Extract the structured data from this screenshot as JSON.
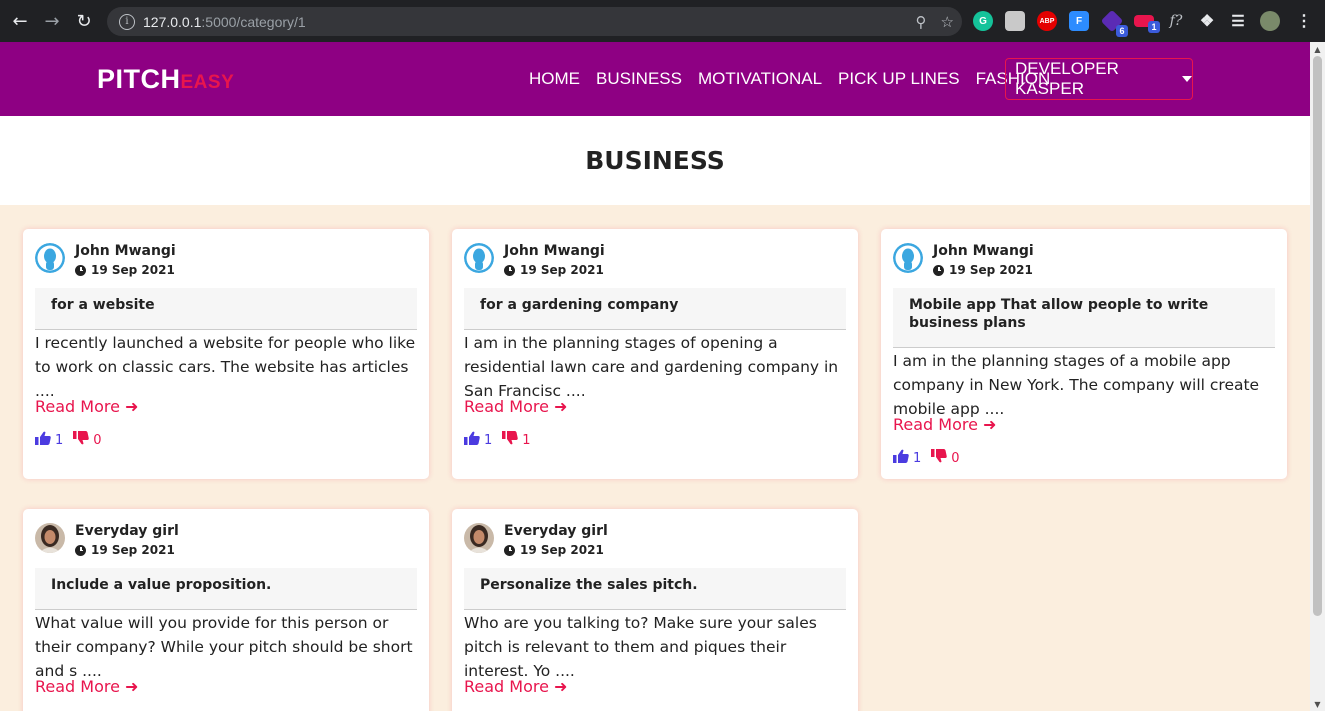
{
  "browser": {
    "url_host": "127.0.0.1",
    "url_path": ":5000/category/1",
    "extensions": [
      {
        "icon": "grammarly-icon",
        "color": "#15c39a",
        "text": "G"
      },
      {
        "icon": "ext-hand-icon",
        "color": "#c9c9c9",
        "text": ""
      },
      {
        "icon": "adblock-icon",
        "color": "#e40000",
        "text": "ABP"
      },
      {
        "icon": "ext-doc-icon",
        "color": "#2d8cff",
        "text": "F"
      },
      {
        "icon": "ext-purple-icon",
        "color": "#5b2bb5",
        "text": "",
        "badge": "6"
      },
      {
        "icon": "ext-toggle-icon",
        "color": "#e8154d",
        "text": "",
        "badge": "1"
      },
      {
        "icon": "formula-icon",
        "color": "",
        "text": "f?"
      }
    ]
  },
  "site": {
    "brand_main": "PITCH",
    "brand_sub": "EASY",
    "nav": [
      "HOME",
      "BUSINESS",
      "MOTIVATIONAL",
      "PICK UP LINES",
      "FASHION"
    ],
    "user_dropdown": "DEVELOPER KASPER",
    "colors": {
      "navbar": "#8e0083",
      "accent": "#e8154d",
      "page_bg": "#fbeede",
      "like": "#4b3be0"
    }
  },
  "category_title": "BUSINESS",
  "read_more_label": "Read More",
  "pitches": [
    {
      "author": "John Mwangi",
      "avatar": "blue-user-avatar",
      "date": "19 Sep 2021",
      "title": "for a website",
      "body": "I recently launched a website for people who like to work on classic cars. The website has articles ....",
      "likes": "1",
      "dislikes": "0"
    },
    {
      "author": "John Mwangi",
      "avatar": "blue-user-avatar",
      "date": "19 Sep 2021",
      "title": "for a gardening company",
      "body": "I am in the planning stages of opening a residential lawn care and gardening company in San Francisc ....",
      "likes": "1",
      "dislikes": "1"
    },
    {
      "author": "John Mwangi",
      "avatar": "blue-user-avatar",
      "date": "19 Sep 2021",
      "title": "Mobile app That allow people to write business plans",
      "body": "I am in the planning stages of a mobile app company in New York. The company will create mobile app ....",
      "likes": "1",
      "dislikes": "0"
    },
    {
      "author": "Everyday girl",
      "avatar": "photo-avatar",
      "date": "19 Sep 2021",
      "title": "Include a value proposition.",
      "body": "What value will you provide for this person or their company? While your pitch should be short and s ....",
      "likes": "",
      "dislikes": ""
    },
    {
      "author": "Everyday girl",
      "avatar": "photo-avatar",
      "date": "19 Sep 2021",
      "title": "Personalize the sales pitch.",
      "body": "Who are you talking to? Make sure your sales pitch is relevant to them and piques their interest. Yo ....",
      "likes": "",
      "dislikes": ""
    }
  ]
}
